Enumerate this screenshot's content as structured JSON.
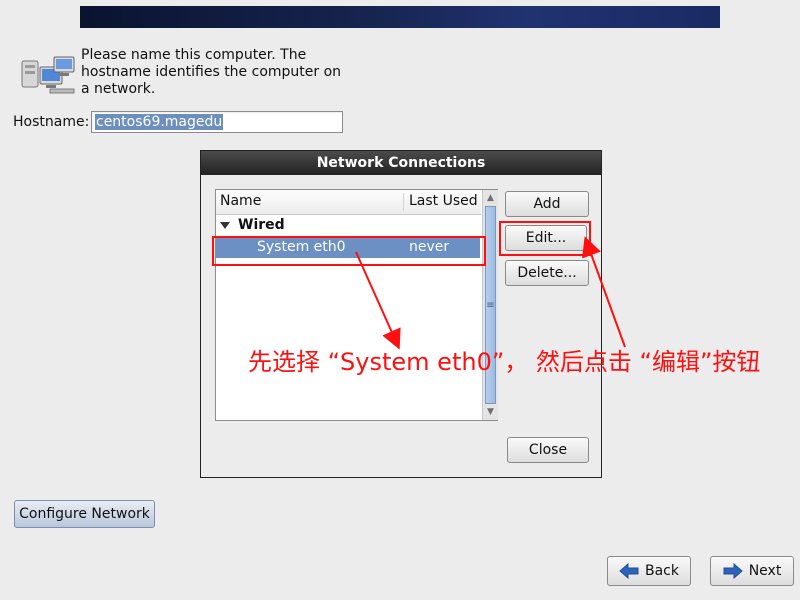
{
  "header": {
    "banner_color": "#16244f"
  },
  "intro": {
    "icon": "network-computers-icon",
    "text": "Please name this computer.  The hostname identifies the computer on a network."
  },
  "hostname": {
    "label": "Hostname:",
    "value": "centos69.magedu"
  },
  "dialog": {
    "title": "Network Connections",
    "columns": {
      "name": "Name",
      "last_used": "Last Used"
    },
    "group": {
      "label": "Wired",
      "icon": "triangle-down-icon"
    },
    "selected_row": {
      "name": "System eth0",
      "last_used": "never"
    },
    "buttons": {
      "add": "Add",
      "edit": "Edit...",
      "delete": "Delete...",
      "close": "Close"
    },
    "scrollbar": {
      "up_icon": "scroll-up-icon",
      "down_icon": "scroll-down-icon",
      "thumb_grip": "≡"
    }
  },
  "configure_network_label": "Configure Network",
  "navigation": {
    "back_label": "Back",
    "next_label": "Next",
    "back_icon": "left-arrow-icon",
    "next_icon": "right-arrow-icon"
  },
  "annotation": {
    "text": "先选择 “System eth0”， 然后点击 “编辑”按钮",
    "color": "#ff1010"
  },
  "colors": {
    "selection": "#6c90c3",
    "titlebar": "#2f2f2f"
  }
}
